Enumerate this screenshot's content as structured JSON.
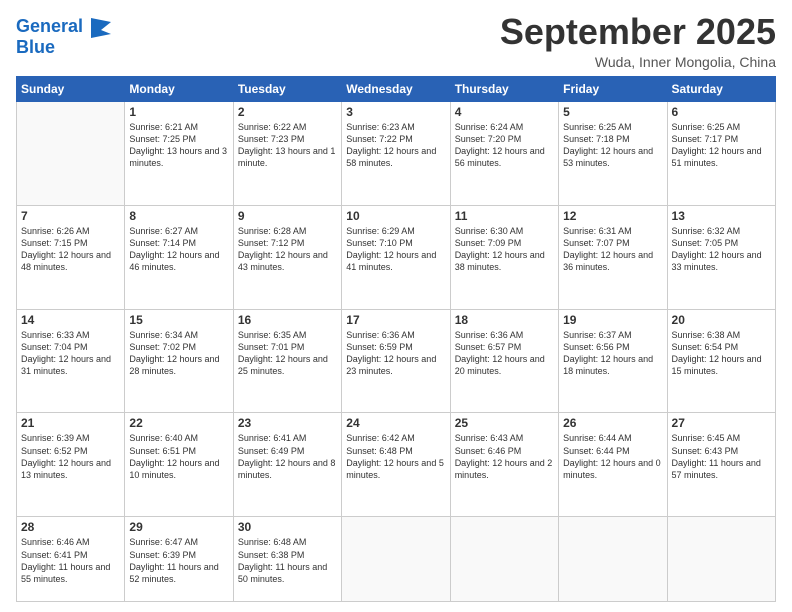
{
  "logo": {
    "line1": "General",
    "line2": "Blue",
    "icon_color": "#1a6abf"
  },
  "header": {
    "month": "September 2025",
    "location": "Wuda, Inner Mongolia, China"
  },
  "weekdays": [
    "Sunday",
    "Monday",
    "Tuesday",
    "Wednesday",
    "Thursday",
    "Friday",
    "Saturday"
  ],
  "weeks": [
    [
      {
        "day": "",
        "sunrise": "",
        "sunset": "",
        "daylight": ""
      },
      {
        "day": "1",
        "sunrise": "Sunrise: 6:21 AM",
        "sunset": "Sunset: 7:25 PM",
        "daylight": "Daylight: 13 hours and 3 minutes."
      },
      {
        "day": "2",
        "sunrise": "Sunrise: 6:22 AM",
        "sunset": "Sunset: 7:23 PM",
        "daylight": "Daylight: 13 hours and 1 minute."
      },
      {
        "day": "3",
        "sunrise": "Sunrise: 6:23 AM",
        "sunset": "Sunset: 7:22 PM",
        "daylight": "Daylight: 12 hours and 58 minutes."
      },
      {
        "day": "4",
        "sunrise": "Sunrise: 6:24 AM",
        "sunset": "Sunset: 7:20 PM",
        "daylight": "Daylight: 12 hours and 56 minutes."
      },
      {
        "day": "5",
        "sunrise": "Sunrise: 6:25 AM",
        "sunset": "Sunset: 7:18 PM",
        "daylight": "Daylight: 12 hours and 53 minutes."
      },
      {
        "day": "6",
        "sunrise": "Sunrise: 6:25 AM",
        "sunset": "Sunset: 7:17 PM",
        "daylight": "Daylight: 12 hours and 51 minutes."
      }
    ],
    [
      {
        "day": "7",
        "sunrise": "Sunrise: 6:26 AM",
        "sunset": "Sunset: 7:15 PM",
        "daylight": "Daylight: 12 hours and 48 minutes."
      },
      {
        "day": "8",
        "sunrise": "Sunrise: 6:27 AM",
        "sunset": "Sunset: 7:14 PM",
        "daylight": "Daylight: 12 hours and 46 minutes."
      },
      {
        "day": "9",
        "sunrise": "Sunrise: 6:28 AM",
        "sunset": "Sunset: 7:12 PM",
        "daylight": "Daylight: 12 hours and 43 minutes."
      },
      {
        "day": "10",
        "sunrise": "Sunrise: 6:29 AM",
        "sunset": "Sunset: 7:10 PM",
        "daylight": "Daylight: 12 hours and 41 minutes."
      },
      {
        "day": "11",
        "sunrise": "Sunrise: 6:30 AM",
        "sunset": "Sunset: 7:09 PM",
        "daylight": "Daylight: 12 hours and 38 minutes."
      },
      {
        "day": "12",
        "sunrise": "Sunrise: 6:31 AM",
        "sunset": "Sunset: 7:07 PM",
        "daylight": "Daylight: 12 hours and 36 minutes."
      },
      {
        "day": "13",
        "sunrise": "Sunrise: 6:32 AM",
        "sunset": "Sunset: 7:05 PM",
        "daylight": "Daylight: 12 hours and 33 minutes."
      }
    ],
    [
      {
        "day": "14",
        "sunrise": "Sunrise: 6:33 AM",
        "sunset": "Sunset: 7:04 PM",
        "daylight": "Daylight: 12 hours and 31 minutes."
      },
      {
        "day": "15",
        "sunrise": "Sunrise: 6:34 AM",
        "sunset": "Sunset: 7:02 PM",
        "daylight": "Daylight: 12 hours and 28 minutes."
      },
      {
        "day": "16",
        "sunrise": "Sunrise: 6:35 AM",
        "sunset": "Sunset: 7:01 PM",
        "daylight": "Daylight: 12 hours and 25 minutes."
      },
      {
        "day": "17",
        "sunrise": "Sunrise: 6:36 AM",
        "sunset": "Sunset: 6:59 PM",
        "daylight": "Daylight: 12 hours and 23 minutes."
      },
      {
        "day": "18",
        "sunrise": "Sunrise: 6:36 AM",
        "sunset": "Sunset: 6:57 PM",
        "daylight": "Daylight: 12 hours and 20 minutes."
      },
      {
        "day": "19",
        "sunrise": "Sunrise: 6:37 AM",
        "sunset": "Sunset: 6:56 PM",
        "daylight": "Daylight: 12 hours and 18 minutes."
      },
      {
        "day": "20",
        "sunrise": "Sunrise: 6:38 AM",
        "sunset": "Sunset: 6:54 PM",
        "daylight": "Daylight: 12 hours and 15 minutes."
      }
    ],
    [
      {
        "day": "21",
        "sunrise": "Sunrise: 6:39 AM",
        "sunset": "Sunset: 6:52 PM",
        "daylight": "Daylight: 12 hours and 13 minutes."
      },
      {
        "day": "22",
        "sunrise": "Sunrise: 6:40 AM",
        "sunset": "Sunset: 6:51 PM",
        "daylight": "Daylight: 12 hours and 10 minutes."
      },
      {
        "day": "23",
        "sunrise": "Sunrise: 6:41 AM",
        "sunset": "Sunset: 6:49 PM",
        "daylight": "Daylight: 12 hours and 8 minutes."
      },
      {
        "day": "24",
        "sunrise": "Sunrise: 6:42 AM",
        "sunset": "Sunset: 6:48 PM",
        "daylight": "Daylight: 12 hours and 5 minutes."
      },
      {
        "day": "25",
        "sunrise": "Sunrise: 6:43 AM",
        "sunset": "Sunset: 6:46 PM",
        "daylight": "Daylight: 12 hours and 2 minutes."
      },
      {
        "day": "26",
        "sunrise": "Sunrise: 6:44 AM",
        "sunset": "Sunset: 6:44 PM",
        "daylight": "Daylight: 12 hours and 0 minutes."
      },
      {
        "day": "27",
        "sunrise": "Sunrise: 6:45 AM",
        "sunset": "Sunset: 6:43 PM",
        "daylight": "Daylight: 11 hours and 57 minutes."
      }
    ],
    [
      {
        "day": "28",
        "sunrise": "Sunrise: 6:46 AM",
        "sunset": "Sunset: 6:41 PM",
        "daylight": "Daylight: 11 hours and 55 minutes."
      },
      {
        "day": "29",
        "sunrise": "Sunrise: 6:47 AM",
        "sunset": "Sunset: 6:39 PM",
        "daylight": "Daylight: 11 hours and 52 minutes."
      },
      {
        "day": "30",
        "sunrise": "Sunrise: 6:48 AM",
        "sunset": "Sunset: 6:38 PM",
        "daylight": "Daylight: 11 hours and 50 minutes."
      },
      {
        "day": "",
        "sunrise": "",
        "sunset": "",
        "daylight": ""
      },
      {
        "day": "",
        "sunrise": "",
        "sunset": "",
        "daylight": ""
      },
      {
        "day": "",
        "sunrise": "",
        "sunset": "",
        "daylight": ""
      },
      {
        "day": "",
        "sunrise": "",
        "sunset": "",
        "daylight": ""
      }
    ]
  ]
}
